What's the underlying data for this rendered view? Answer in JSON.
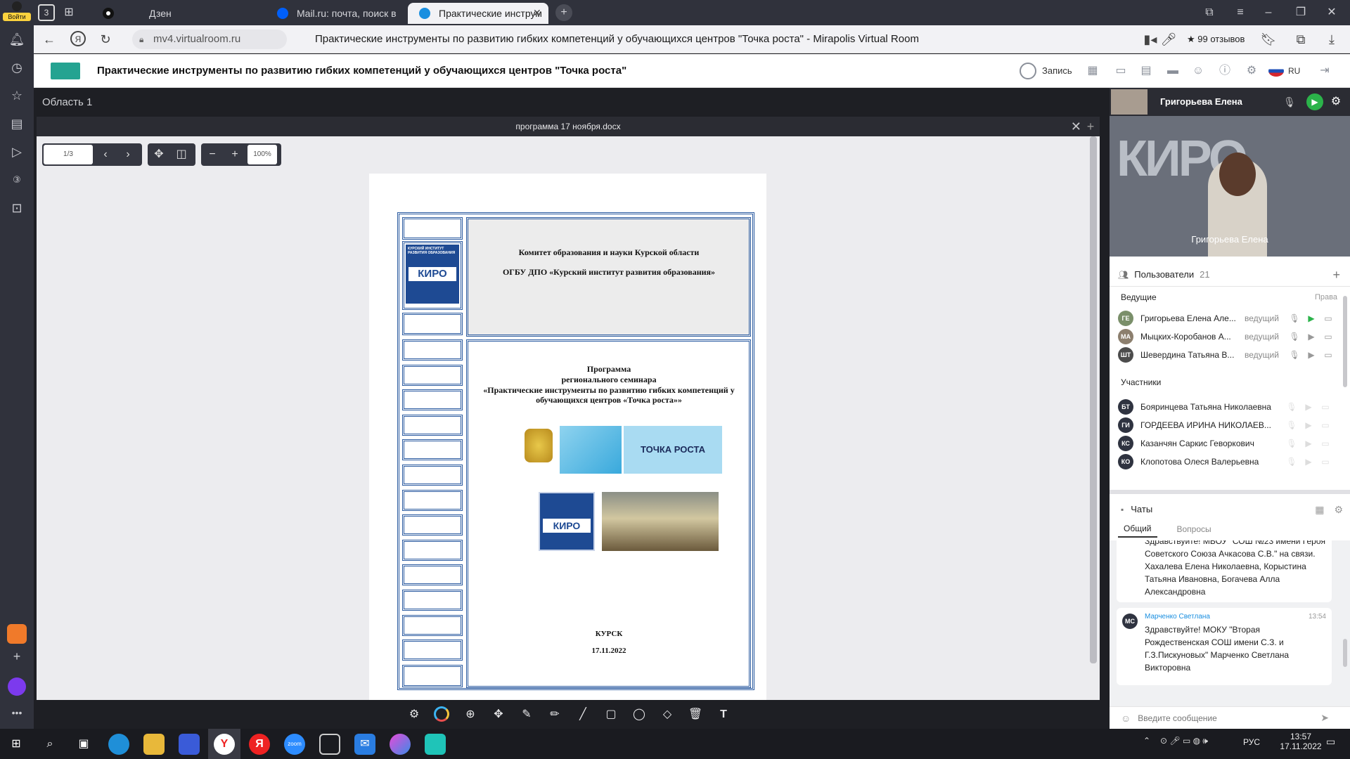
{
  "browser": {
    "login_label": "Войти",
    "tab_count": "3",
    "tabs": [
      {
        "label": "Дзен",
        "active": false
      },
      {
        "label": "Mail.ru: почта, поиск в ин",
        "active": false
      },
      {
        "label": "Практические инструм",
        "active": true
      }
    ],
    "url": "mv4.virtualroom.ru",
    "page_title": "Практические инструменты по развитию гибких компетенций у обучающихся центров \"Точка роста\" - Mirapolis Virtual Room",
    "reviews": "★ 99 отзывов"
  },
  "app": {
    "title": "Практические инструменты по развитию гибких компетенций у обучающихся центров \"Точка роста\"",
    "record_label": "Запись",
    "language": "RU",
    "area_label": "Область 1"
  },
  "document": {
    "filename": "программа 17 ноября.docx",
    "page_indicator": "1/3",
    "zoom": "100%",
    "header_line1": "Комитет образования и науки Курской области",
    "header_line2": "ОГБУ ДПО «Курский институт развития образования»",
    "kiro_caption": "КУРСКИЙ ИНСТИТУТ РАЗВИТИЯ ОБРАЗОВАНИЯ",
    "kiro_logo": "КИРО",
    "program_title": "Программа",
    "program_subtitle": "регионального семинара",
    "program_name": "«Практические инструменты по развитию гибких компетенций у обучающихся центров «Точка роста»»",
    "tochka_rosta_logo": "ТОЧКА РОСТА",
    "city": "КУРСК",
    "date": "17.11.2022"
  },
  "presenter": {
    "name": "Григорьева Елена",
    "video_overlay_name": "Григорьева Елена"
  },
  "users": {
    "title": "Пользователи",
    "count": "21",
    "hosts_label": "Ведущие",
    "rights_label": "Права",
    "participants_label": "Участники",
    "hosts": [
      {
        "initials": "ГЕ",
        "name": "Григорьева Елена Але...",
        "role": "ведущий"
      },
      {
        "initials": "МА",
        "name": "Мыцких-Коробанов А...",
        "role": "ведущий"
      },
      {
        "initials": "ШТ",
        "name": "Шевердина Татьяна В...",
        "role": "ведущий"
      }
    ],
    "participants": [
      {
        "initials": "БТ",
        "name": "Бояринцева Татьяна Николаевна"
      },
      {
        "initials": "ГИ",
        "name": "ГОРДЕЕВА ИРИНА НИКОЛАЕВ..."
      },
      {
        "initials": "КС",
        "name": "Казанчян Саркис Геворкович"
      },
      {
        "initials": "КО",
        "name": "Клопотова Олеся Валерьевна"
      }
    ]
  },
  "chat": {
    "title": "Чаты",
    "tabs": [
      "Общий",
      "Вопросы"
    ],
    "message1": "Здравствуйте! МБОУ \"СОШ №23 имени Героя Советского Союза Ачкасова С.В.\" на связи. Хахалева Елена Николаевна, Корыстина Татьяна Ивановна, Богачева Алла Александровна",
    "message2_author": "Марченко Светлана",
    "message2_initials": "МС",
    "message2_time": "13:54",
    "message2": "Здравствуйте! МОКУ \"Вторая Рождественская СОШ имени С.З. и Г.З.Пискуновых\" Марченко Светлана Викторовна",
    "input_placeholder": "Введите сообщение"
  },
  "taskbar": {
    "lang": "РУС",
    "time": "13:57",
    "date": "17.11.2022",
    "zoom_label": "zoom"
  },
  "colors": {
    "accent_green": "#24a391",
    "doc_border": "#2a5aa0",
    "tochka_red": "#d7262c"
  }
}
